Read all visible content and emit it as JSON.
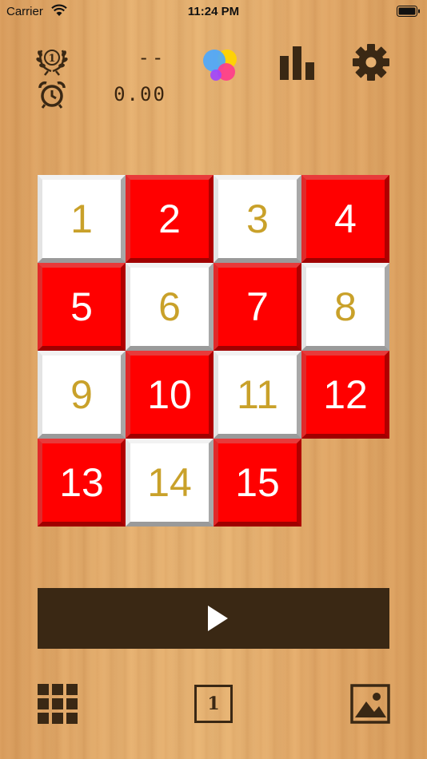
{
  "status_bar": {
    "carrier": "Carrier",
    "time": "11:24 PM"
  },
  "header": {
    "best_score": "--",
    "timer": "0.00",
    "best_badge_digit": "1",
    "icons": [
      "laurel-icon",
      "alarm-clock-icon",
      "game-center-icon",
      "bar-chart-icon",
      "gear-icon"
    ]
  },
  "board": {
    "columns": 4,
    "rows": 4,
    "tiles": [
      {
        "label": "1",
        "color": "white"
      },
      {
        "label": "2",
        "color": "red"
      },
      {
        "label": "3",
        "color": "white"
      },
      {
        "label": "4",
        "color": "red"
      },
      {
        "label": "5",
        "color": "red"
      },
      {
        "label": "6",
        "color": "white"
      },
      {
        "label": "7",
        "color": "red"
      },
      {
        "label": "8",
        "color": "white"
      },
      {
        "label": "9",
        "color": "white"
      },
      {
        "label": "10",
        "color": "red"
      },
      {
        "label": "11",
        "color": "white"
      },
      {
        "label": "12",
        "color": "red"
      },
      {
        "label": "13",
        "color": "red"
      },
      {
        "label": "14",
        "color": "white"
      },
      {
        "label": "15",
        "color": "red"
      }
    ],
    "empty_slot": 16
  },
  "toolbar": {
    "one_label": "1",
    "icons": [
      "grid-icon",
      "image-icon"
    ]
  },
  "colors": {
    "tile_red": "#ff0000",
    "tile_white": "#ffffff",
    "white_tile_text": "#c9a12a",
    "dark_brown": "#3a2814"
  }
}
